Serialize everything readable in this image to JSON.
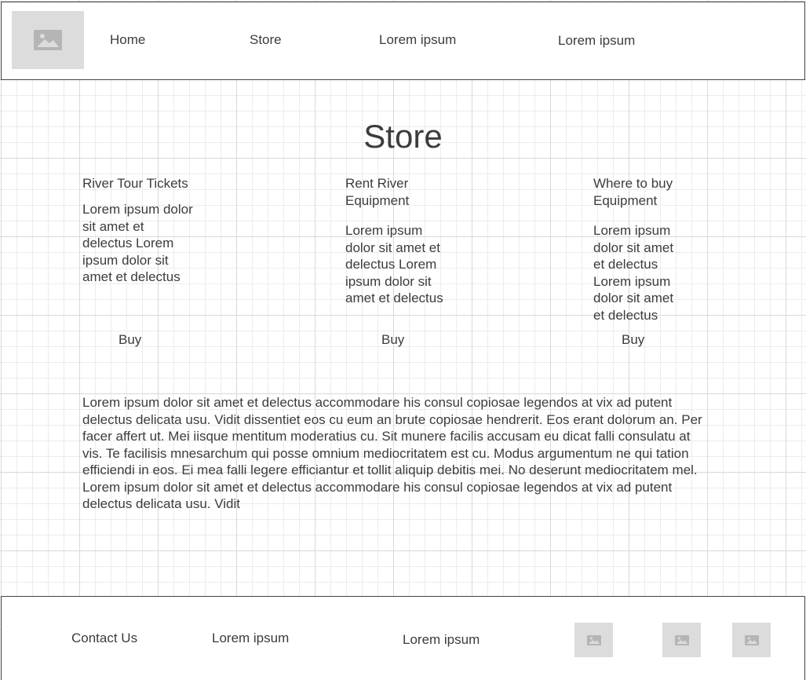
{
  "header": {
    "nav": [
      "Home",
      "Store",
      "Lorem ipsum",
      "Lorem ipsum"
    ]
  },
  "main": {
    "title": "Store",
    "columns": [
      {
        "title": "River Tour Tickets",
        "body": "Lorem ipsum dolor sit amet et delectus Lorem ipsum dolor sit amet et delectus",
        "button": "Buy"
      },
      {
        "title": "Rent River Equipment",
        "body": "Lorem ipsum dolor sit amet et delectus Lorem ipsum dolor sit amet et delectus",
        "button": "Buy"
      },
      {
        "title": "Where to buy Equipment",
        "body": "Lorem ipsum dolor sit amet et delectus Lorem ipsum dolor sit amet et delectus",
        "button": "Buy"
      }
    ],
    "paragraph": "Lorem ipsum dolor sit amet et delectus accommodare his consul copiosae legendos at vix ad putent delectus delicata usu. Vidit dissentiet eos cu eum an brute copiosae hendrerit. Eos erant dolorum an. Per facer affert ut. Mei iisque mentitum moderatius cu. Sit munere facilis accusam eu dicat falli consulatu at vis. Te facilisis mnesarchum qui posse omnium mediocritatem est cu. Modus argumentum ne qui tation efficiendi in eos. Ei mea falli legere efficiantur et tollit aliquip debitis mei. No deserunt mediocritatem mel. Lorem ipsum dolor sit amet et delectus accommodare his consul copiosae legendos at vix ad putent delectus delicata usu. Vidit"
  },
  "footer": {
    "links": [
      "Contact Us",
      "Lorem ipsum",
      "Lorem ipsum"
    ]
  }
}
